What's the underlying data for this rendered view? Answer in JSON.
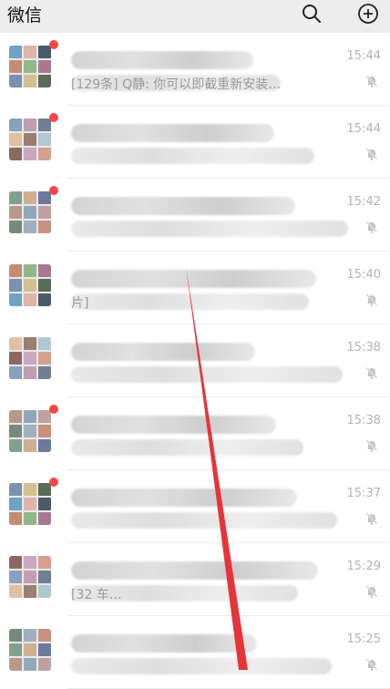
{
  "header": {
    "title": "微信",
    "search_icon": "search-icon",
    "add_icon": "plus-circle-icon",
    "background": "#ededed"
  },
  "chats": [
    {
      "name": "",
      "preview": "[129条] Q静: 你可以即截重新安装…",
      "time": "15:44",
      "unread": true,
      "muted": true
    },
    {
      "name": "",
      "preview": "",
      "time": "15:44",
      "unread": true,
      "muted": true
    },
    {
      "name": "",
      "preview": "",
      "time": "15:42",
      "unread": true,
      "muted": true
    },
    {
      "name": "",
      "preview": "片]",
      "time": "15:40",
      "unread": false,
      "muted": true
    },
    {
      "name": "",
      "preview": "",
      "time": "15:38",
      "unread": false,
      "muted": true
    },
    {
      "name": "",
      "preview": "",
      "time": "15:38",
      "unread": true,
      "muted": true
    },
    {
      "name": "",
      "preview": "",
      "time": "15:37",
      "unread": true,
      "muted": true
    },
    {
      "name": "",
      "preview": "[32 车…",
      "time": "15:29",
      "unread": false,
      "muted": true
    },
    {
      "name": "",
      "preview": "",
      "time": "15:25",
      "unread": false,
      "muted": true
    }
  ],
  "colors": {
    "unread_dot": "#f04848",
    "arrow": "#e8333a",
    "time_text": "#b3b3b3",
    "preview_text": "#9b9b9b"
  }
}
